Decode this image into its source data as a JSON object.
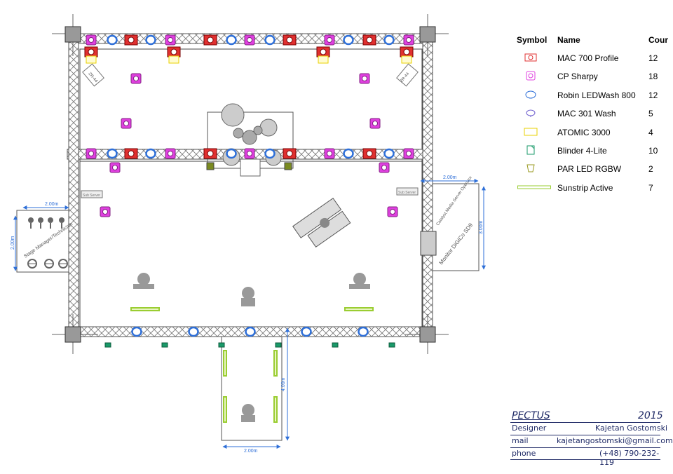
{
  "legend": {
    "headers": {
      "symbol": "Symbol",
      "name": "Name",
      "count": "Cour"
    },
    "items": [
      {
        "name": "MAC 700 Profile",
        "count": "12",
        "icon": "mac700-icon",
        "color": "#e03030"
      },
      {
        "name": "CP Sharpy",
        "count": "18",
        "icon": "sharpy-icon",
        "color": "#e040e0"
      },
      {
        "name": "Robin LEDWash 800",
        "count": "12",
        "icon": "ledwash-icon",
        "color": "#2e6fd8"
      },
      {
        "name": "MAC 301 Wash",
        "count": "5",
        "icon": "mac301-icon",
        "color": "#6a5acd"
      },
      {
        "name": "ATOMIC 3000",
        "count": "4",
        "icon": "atomic-icon",
        "color": "#e8d000"
      },
      {
        "name": "Blinder 4-Lite",
        "count": "10",
        "icon": "blinder-icon",
        "color": "#1a9a6a"
      },
      {
        "name": "PAR LED RGBW",
        "count": "2",
        "icon": "par-icon",
        "color": "#9a9a20"
      },
      {
        "name": "Sunstrip Active",
        "count": "7",
        "icon": "sunstrip-icon",
        "color": "#9acd32"
      }
    ]
  },
  "title_block": {
    "project": "PECTUS",
    "year": "2015",
    "designer_label": "Designer",
    "designer": "Kajetan Gostomski",
    "mail_label": "mail",
    "mail": "kajetangostomski@gmail.com",
    "phone_label": "phone",
    "phone": "(+48) 790-232-119"
  },
  "plot": {
    "dimensions": [
      "2.00m",
      "2.00m",
      "2.00m",
      "3.00m",
      "4.00m",
      "2.00m"
    ],
    "labels": {
      "stage_manager": "Stage Manager/Technician",
      "catalyst": "Catalyst Media Server Operator",
      "monitor": "Monitor DiGiCo SD9",
      "zr_left": "ZR-44",
      "zr_right": "ZR-44",
      "small_left": "Sub Server",
      "small_right": "Sub Server"
    },
    "colors": {
      "truss": "#666666",
      "dimension": "#2e6fd8",
      "mac700": "#e03030",
      "sharpy": "#e040e0",
      "ledwash": "#2e6fd8",
      "atomic": "#e8d000",
      "blinder": "#1a9a6a",
      "par": "#9a9a20",
      "sunstrip": "#9acd32"
    }
  }
}
